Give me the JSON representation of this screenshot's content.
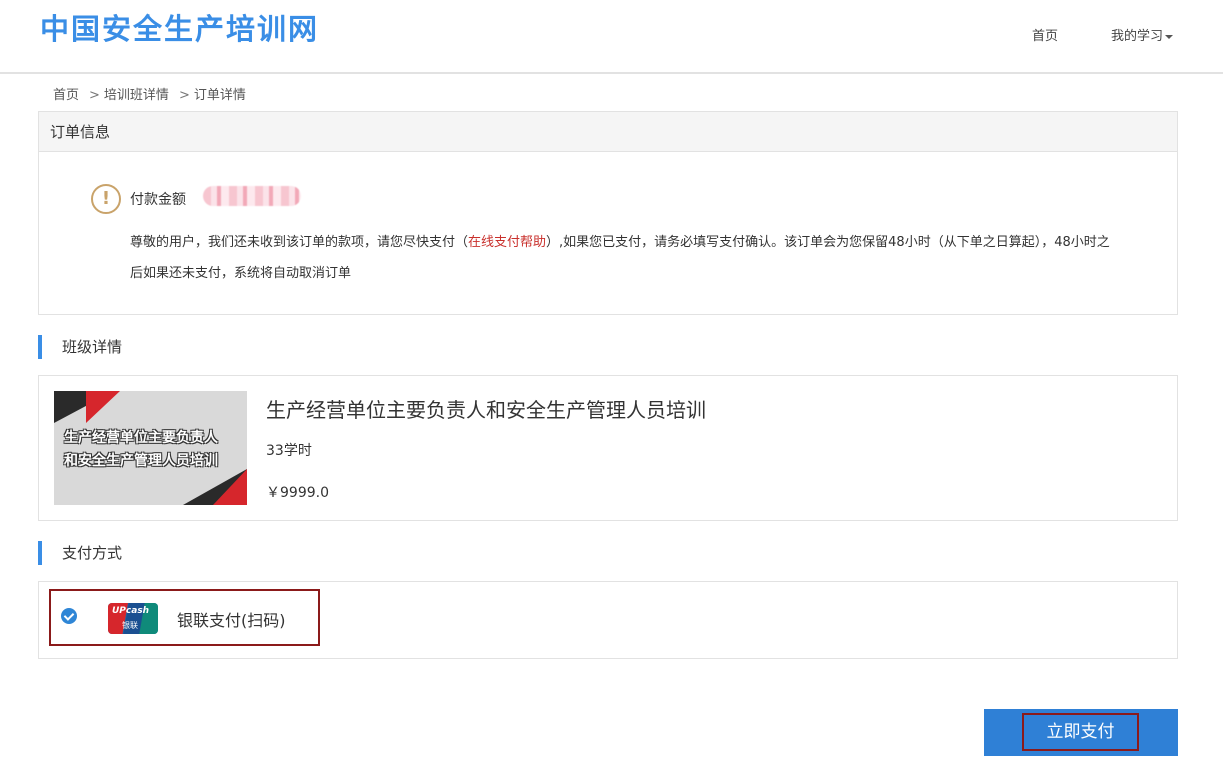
{
  "header": {
    "logo": "中国安全生产培训网",
    "nav": {
      "home": "首页",
      "my_study": "我的学习"
    }
  },
  "breadcrumb": {
    "items": [
      "首页",
      "培训班详情",
      "订单详情"
    ],
    "separator": ">"
  },
  "order_info": {
    "title": "订单信息",
    "amount_label": "付款金额",
    "amount_value": "",
    "notice_before": "尊敬的用户，我们还未收到该订单的款项，请您尽快支付（",
    "notice_link": "在线支付帮助",
    "notice_after": "）,如果您已支付，请务必填写支付确认。该订单会为您保留48小时（从下单之日算起），48小时之后如果还未支付，系统将自动取消订单"
  },
  "class_section": {
    "title": "班级详情",
    "thumbnail_text_line1": "生产经营单位主要负责人",
    "thumbnail_text_line2": "和安全生产管理人员培训",
    "name": "生产经营单位主要负责人和安全生产管理人员培训",
    "hours": "33学时",
    "price": "￥9999.0"
  },
  "payment_section": {
    "title": "支付方式",
    "option_label": "银联支付(扫码)",
    "logo_text": "UPcash",
    "logo_sub": "银联",
    "selected": true
  },
  "pay_button": {
    "label": "立即支付"
  },
  "colors": {
    "brand": "#3a8ee6",
    "button": "#2f80d6",
    "highlight_border": "#8b1a1a",
    "link_red": "#c9302c"
  }
}
